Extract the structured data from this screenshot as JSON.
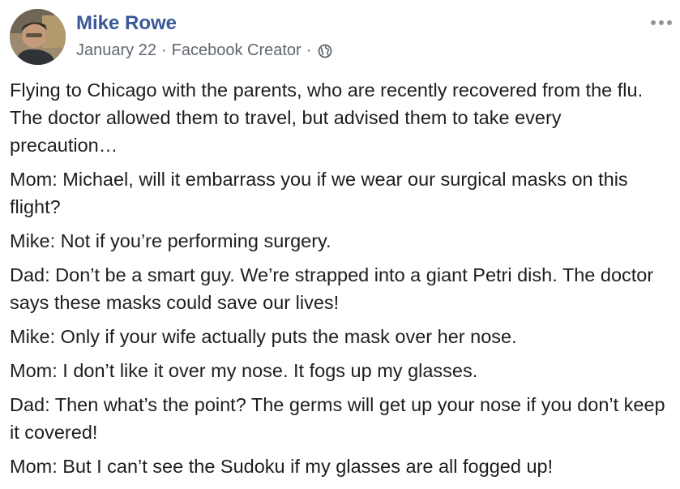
{
  "post": {
    "author": "Mike Rowe",
    "date": "January 22",
    "separator": "·",
    "source": "Facebook Creator",
    "privacy_icon": "globe-icon",
    "more_icon": "more-options-icon",
    "paragraphs": [
      "Flying to Chicago with the parents, who are recently recovered from the flu. The doctor allowed them to travel, but advised them to take every precaution…",
      "Mom: Michael, will it embarrass you if we wear our surgical masks on this flight?",
      "Mike: Not if you’re performing surgery.",
      "Dad: Don’t be a smart guy. We’re strapped into a giant Petri dish. The doctor says these masks could save our lives!",
      "Mike: Only if your wife actually puts the mask over her nose.",
      "Mom: I don’t like it over my nose. It fogs up my glasses.",
      "Dad: Then what’s the point? The germs will get up your nose if you don’t keep it covered!",
      "Mom: But I can’t see the Sudoku if my glasses are all fogged up!"
    ]
  },
  "colors": {
    "author_link": "#385898",
    "meta_text": "#606770",
    "body_text": "#1c1e21"
  }
}
